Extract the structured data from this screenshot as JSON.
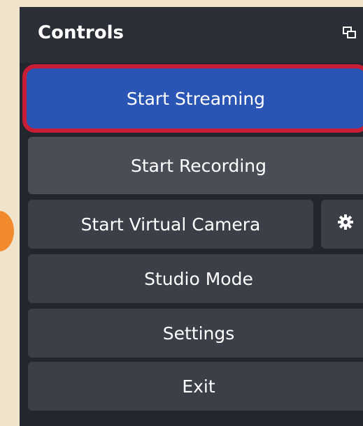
{
  "panel": {
    "title": "Controls"
  },
  "buttons": {
    "start_streaming": "Start Streaming",
    "start_recording": "Start Recording",
    "start_virtual_camera": "Start Virtual Camera",
    "studio_mode": "Studio Mode",
    "settings": "Settings",
    "exit": "Exit"
  },
  "icons": {
    "dock": "undock-window-icon",
    "virtual_camera_settings": "gear-icon"
  },
  "colors": {
    "background": "#efe3cc",
    "panel": "#23262d",
    "button": "#3c3f48",
    "streaming_button": "#2b55b4",
    "highlight_border": "#c81d37",
    "marker": "#f08a2c"
  }
}
